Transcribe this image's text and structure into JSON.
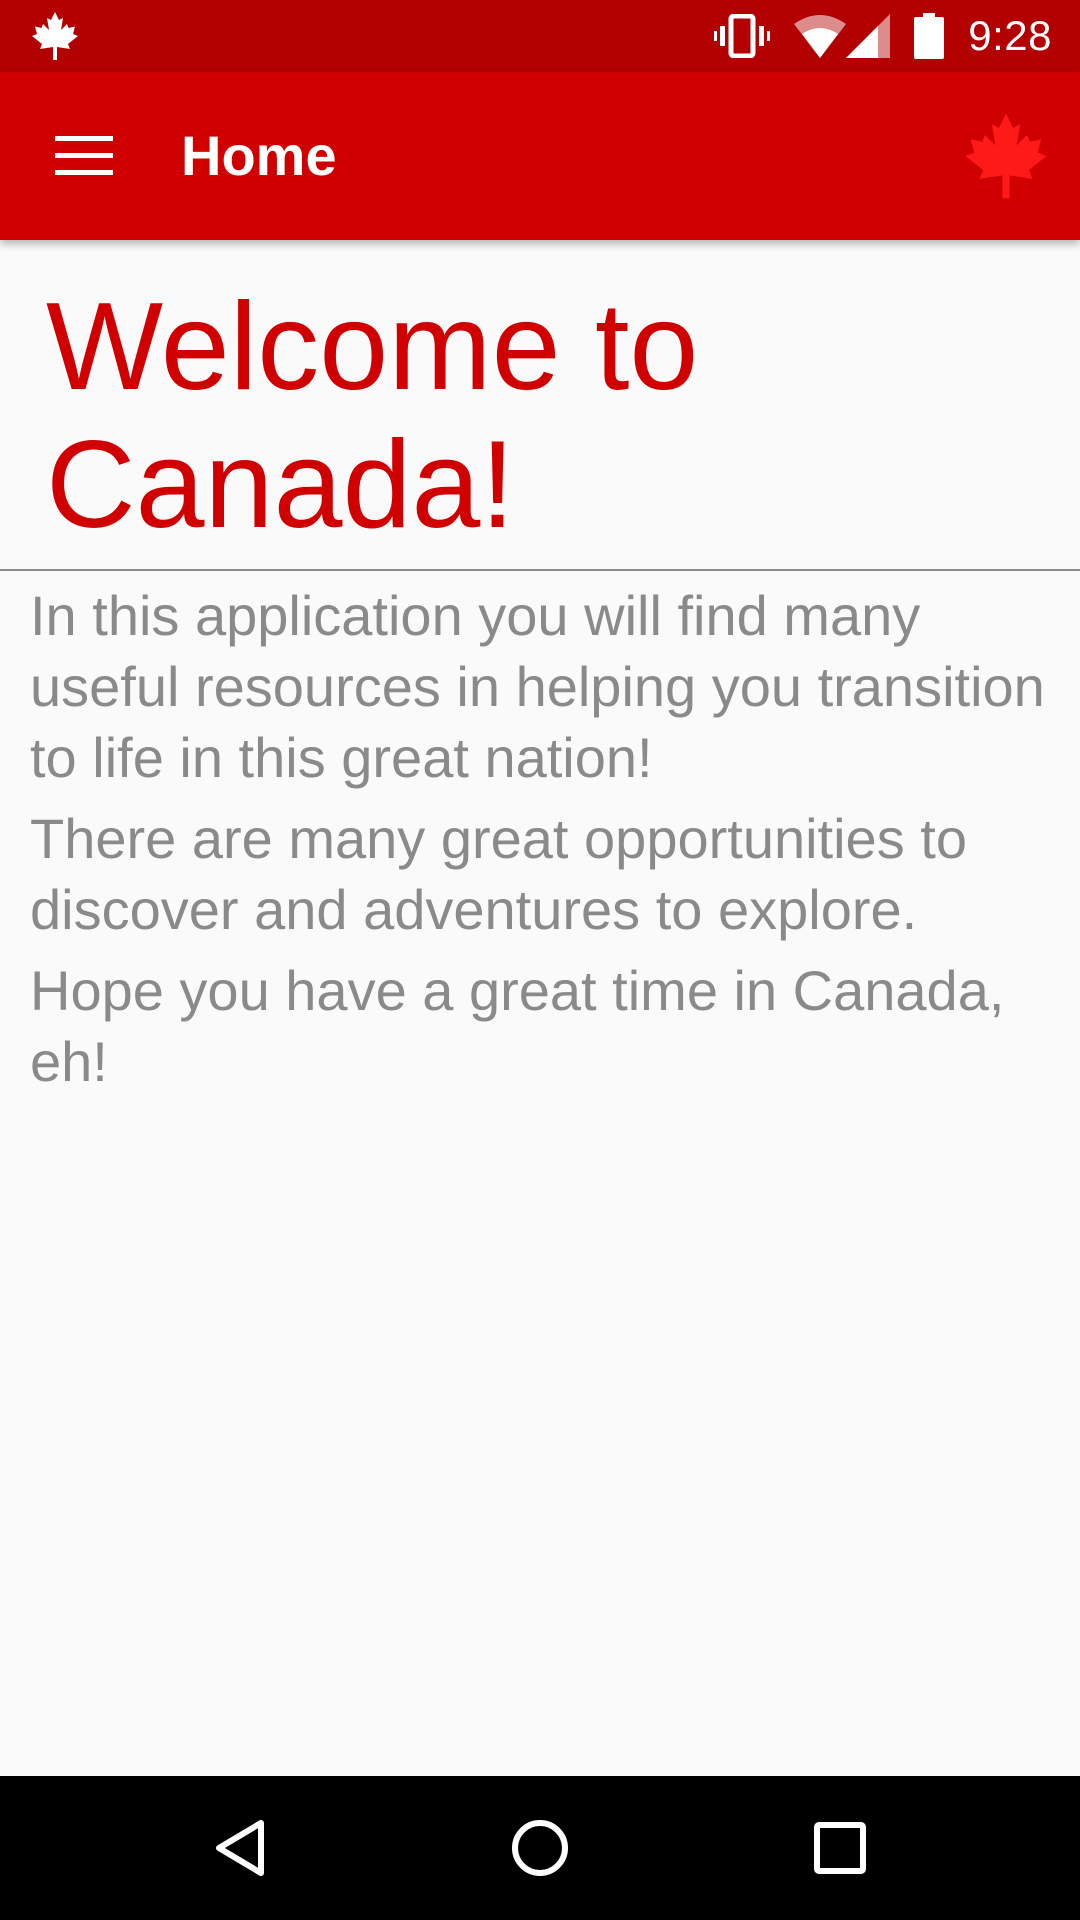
{
  "status_bar": {
    "time": "9:28",
    "icons": [
      "maple-leaf-icon",
      "vibrate-icon",
      "wifi-icon",
      "signal-icon",
      "battery-icon"
    ]
  },
  "app_bar": {
    "title": "Home",
    "icons": [
      "menu-icon",
      "maple-leaf-icon"
    ]
  },
  "main": {
    "heading": "Welcome to Canada!",
    "paragraphs": [
      "In this application you will find many useful resources in helping you transition to life in this great nation!",
      "There are many great opportunities to discover and adventures to explore.",
      "Hope you have a great time in Canada, eh!"
    ]
  },
  "nav_bar": {
    "icons": [
      "back-icon",
      "home-icon",
      "recents-icon"
    ]
  },
  "colors": {
    "status_bar": "#b30000",
    "app_bar": "#d10000",
    "heading": "#d10000",
    "body_text": "#8a8a8a",
    "background": "#fafafa",
    "nav_bar": "#000000"
  }
}
